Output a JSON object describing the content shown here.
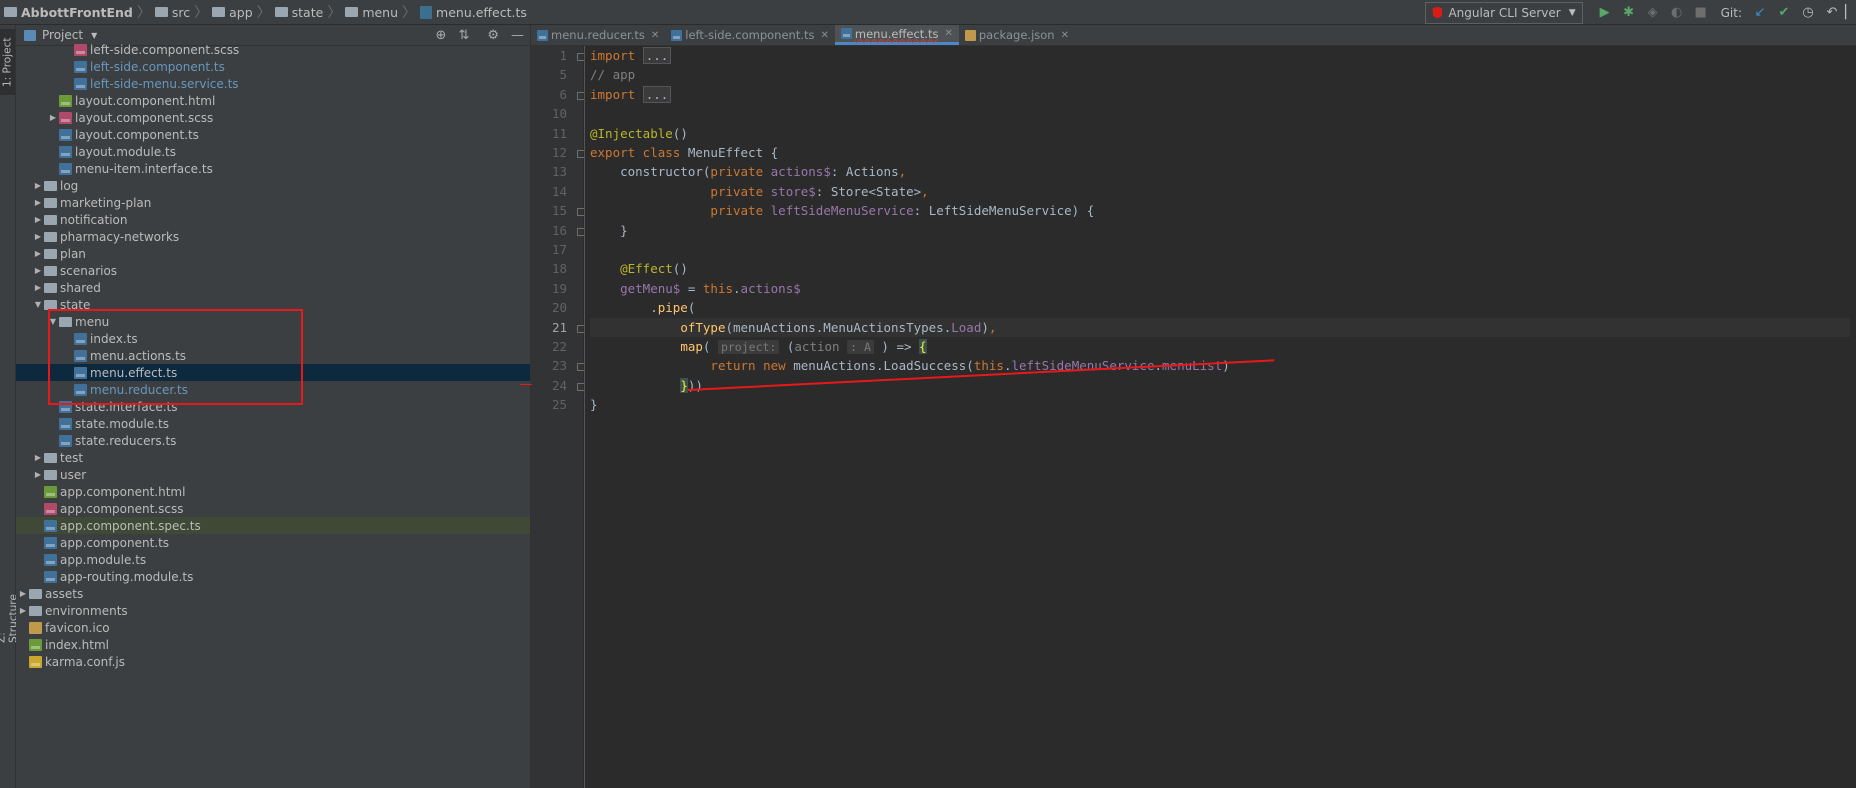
{
  "breadcrumb": [
    {
      "label": "AbbottFrontEnd",
      "icon": "folder-icon"
    },
    {
      "label": "src",
      "icon": "folder-icon"
    },
    {
      "label": "app",
      "icon": "folder-icon"
    },
    {
      "label": "state",
      "icon": "folder-icon"
    },
    {
      "label": "menu",
      "icon": "folder-icon"
    },
    {
      "label": "menu.effect.ts",
      "icon": "typescript-file-icon"
    }
  ],
  "toolbar": {
    "run_config": "Angular CLI Server",
    "vcs_label": "Git:"
  },
  "left_strip": {
    "project_tab": "1: Project",
    "structure_tab": "Z: Structure"
  },
  "project_panel": {
    "title": "Project"
  },
  "tree": [
    {
      "label": "left-side.component.scss",
      "type": "scss",
      "depth": 6,
      "arrow": "",
      "style": ""
    },
    {
      "label": "left-side.component.ts",
      "type": "ts",
      "depth": 6,
      "arrow": "",
      "style": "blue"
    },
    {
      "label": "left-side-menu.service.ts",
      "type": "ts",
      "depth": 6,
      "arrow": "",
      "style": "blue"
    },
    {
      "label": "layout.component.html",
      "type": "html",
      "depth": 5,
      "arrow": "",
      "style": ""
    },
    {
      "label": "layout.component.scss",
      "type": "scss",
      "depth": 5,
      "arrow": "closed",
      "style": ""
    },
    {
      "label": "layout.component.ts",
      "type": "ts",
      "depth": 5,
      "arrow": "",
      "style": ""
    },
    {
      "label": "layout.module.ts",
      "type": "ts",
      "depth": 5,
      "arrow": "",
      "style": ""
    },
    {
      "label": "menu-item.interface.ts",
      "type": "ts",
      "depth": 5,
      "arrow": "",
      "style": ""
    },
    {
      "label": "log",
      "type": "folder",
      "depth": 4,
      "arrow": "closed",
      "style": ""
    },
    {
      "label": "marketing-plan",
      "type": "folder",
      "depth": 4,
      "arrow": "closed",
      "style": ""
    },
    {
      "label": "notification",
      "type": "folder",
      "depth": 4,
      "arrow": "closed",
      "style": ""
    },
    {
      "label": "pharmacy-networks",
      "type": "folder",
      "depth": 4,
      "arrow": "closed",
      "style": ""
    },
    {
      "label": "plan",
      "type": "folder",
      "depth": 4,
      "arrow": "closed",
      "style": ""
    },
    {
      "label": "scenarios",
      "type": "folder",
      "depth": 4,
      "arrow": "closed",
      "style": ""
    },
    {
      "label": "shared",
      "type": "folder",
      "depth": 4,
      "arrow": "closed",
      "style": ""
    },
    {
      "label": "state",
      "type": "folder",
      "depth": 4,
      "arrow": "open",
      "style": ""
    },
    {
      "label": "menu",
      "type": "folder",
      "depth": 5,
      "arrow": "open",
      "style": ""
    },
    {
      "label": "index.ts",
      "type": "ts",
      "depth": 6,
      "arrow": "",
      "style": ""
    },
    {
      "label": "menu.actions.ts",
      "type": "ts",
      "depth": 6,
      "arrow": "",
      "style": ""
    },
    {
      "label": "menu.effect.ts",
      "type": "ts",
      "depth": 6,
      "arrow": "",
      "style": "selected"
    },
    {
      "label": "menu.reducer.ts",
      "type": "ts",
      "depth": 6,
      "arrow": "",
      "style": "blue"
    },
    {
      "label": "state.interface.ts",
      "type": "ts",
      "depth": 5,
      "arrow": "",
      "style": ""
    },
    {
      "label": "state.module.ts",
      "type": "ts",
      "depth": 5,
      "arrow": "",
      "style": ""
    },
    {
      "label": "state.reducers.ts",
      "type": "ts",
      "depth": 5,
      "arrow": "",
      "style": ""
    },
    {
      "label": "test",
      "type": "folder",
      "depth": 4,
      "arrow": "closed",
      "style": ""
    },
    {
      "label": "user",
      "type": "folder",
      "depth": 4,
      "arrow": "closed",
      "style": ""
    },
    {
      "label": "app.component.html",
      "type": "html",
      "depth": 4,
      "arrow": "",
      "style": ""
    },
    {
      "label": "app.component.scss",
      "type": "scss",
      "depth": 4,
      "arrow": "",
      "style": ""
    },
    {
      "label": "app.component.spec.ts",
      "type": "ts",
      "depth": 4,
      "arrow": "",
      "style": "highlight"
    },
    {
      "label": "app.component.ts",
      "type": "ts",
      "depth": 4,
      "arrow": "",
      "style": ""
    },
    {
      "label": "app.module.ts",
      "type": "ts",
      "depth": 4,
      "arrow": "",
      "style": ""
    },
    {
      "label": "app-routing.module.ts",
      "type": "ts",
      "depth": 4,
      "arrow": "",
      "style": ""
    },
    {
      "label": "assets",
      "type": "folder",
      "depth": 3,
      "arrow": "closed",
      "style": ""
    },
    {
      "label": "environments",
      "type": "folder",
      "depth": 3,
      "arrow": "closed",
      "style": ""
    },
    {
      "label": "favicon.ico",
      "type": "ico",
      "depth": 3,
      "arrow": "",
      "style": ""
    },
    {
      "label": "index.html",
      "type": "html",
      "depth": 3,
      "arrow": "",
      "style": ""
    },
    {
      "label": "karma.conf.js",
      "type": "js",
      "depth": 3,
      "arrow": "",
      "style": ""
    }
  ],
  "tabs": [
    {
      "label": "menu.reducer.ts",
      "active": false,
      "err": false,
      "icon": "ts"
    },
    {
      "label": "left-side.component.ts",
      "active": false,
      "err": false,
      "icon": "ts"
    },
    {
      "label": "menu.effect.ts",
      "active": true,
      "err": true,
      "icon": "ts"
    },
    {
      "label": "package.json",
      "active": false,
      "err": false,
      "icon": "json"
    }
  ],
  "line_numbers": [
    "1",
    "5",
    "6",
    "10",
    "11",
    "12",
    "13",
    "14",
    "15",
    "16",
    "17",
    "18",
    "19",
    "20",
    "21",
    "22",
    "23",
    "24",
    "25"
  ],
  "current_line": "21",
  "code": [
    [
      {
        "t": "import ",
        "c": "kw"
      },
      {
        "t": "...",
        "c": "fold-box"
      }
    ],
    [
      {
        "t": "// app",
        "c": "cm"
      }
    ],
    [
      {
        "t": "import ",
        "c": "kw"
      },
      {
        "t": "...",
        "c": "fold-box"
      }
    ],
    [],
    [
      {
        "t": "@Injectable",
        "c": "ann"
      },
      {
        "t": "()",
        "c": ""
      }
    ],
    [
      {
        "t": "export class ",
        "c": "kw"
      },
      {
        "t": "MenuEffect {",
        "c": ""
      }
    ],
    [
      {
        "t": "    constructor(",
        "c": ""
      },
      {
        "t": "private ",
        "c": "kw"
      },
      {
        "t": "actions$",
        "c": "fld"
      },
      {
        "t": ": Actions",
        "c": ""
      },
      {
        "t": ",",
        "c": "kw"
      }
    ],
    [
      {
        "t": "                ",
        "c": ""
      },
      {
        "t": "private ",
        "c": "kw"
      },
      {
        "t": "store$",
        "c": "fld"
      },
      {
        "t": ": Store<State>",
        "c": ""
      },
      {
        "t": ",",
        "c": "kw"
      }
    ],
    [
      {
        "t": "                ",
        "c": ""
      },
      {
        "t": "private ",
        "c": "kw"
      },
      {
        "t": "leftSideMenuService",
        "c": "fld"
      },
      {
        "t": ": LeftSideMenuService) {",
        "c": ""
      }
    ],
    [
      {
        "t": "    }",
        "c": ""
      }
    ],
    [],
    [
      {
        "t": "    ",
        "c": ""
      },
      {
        "t": "@Effect",
        "c": "ann"
      },
      {
        "t": "()",
        "c": ""
      }
    ],
    [
      {
        "t": "    ",
        "c": ""
      },
      {
        "t": "getMenu$",
        "c": "fld"
      },
      {
        "t": " = ",
        "c": ""
      },
      {
        "t": "this",
        "c": "kw"
      },
      {
        "t": ".",
        "c": ""
      },
      {
        "t": "actions$",
        "c": "fld"
      }
    ],
    [
      {
        "t": "        .",
        "c": ""
      },
      {
        "t": "pipe",
        "c": "fn"
      },
      {
        "t": "(",
        "c": ""
      }
    ],
    [
      {
        "t": "            ",
        "c": ""
      },
      {
        "t": "ofType",
        "c": "fn"
      },
      {
        "t": "(menuActions.MenuActionsTypes.",
        "c": ""
      },
      {
        "t": "Load",
        "c": "fld"
      },
      {
        "t": ")",
        "c": ""
      },
      {
        "t": ",",
        "c": "kw"
      }
    ],
    [
      {
        "t": "            ",
        "c": ""
      },
      {
        "t": "map",
        "c": "fn"
      },
      {
        "t": "( ",
        "c": ""
      },
      {
        "t": "project:",
        "c": "hint"
      },
      {
        "t": " (",
        "c": ""
      },
      {
        "t": "action",
        "c": "cm"
      },
      {
        "t": " ",
        "c": ""
      },
      {
        "t": ": A",
        "c": "hint"
      },
      {
        "t": " ) => ",
        "c": ""
      },
      {
        "t": "{",
        "c": "brace-match"
      }
    ],
    [
      {
        "t": "                ",
        "c": ""
      },
      {
        "t": "return new ",
        "c": "kw"
      },
      {
        "t": "menuActions.LoadSuccess(",
        "c": ""
      },
      {
        "t": "this",
        "c": "kw"
      },
      {
        "t": ".",
        "c": ""
      },
      {
        "t": "leftSideMenuService",
        "c": "fld"
      },
      {
        "t": ".",
        "c": ""
      },
      {
        "t": "menuList",
        "c": "fld"
      },
      {
        "t": ")",
        "c": ""
      }
    ],
    [
      {
        "t": "            ",
        "c": ""
      },
      {
        "t": "}",
        "c": "brace-match"
      },
      {
        "t": "))",
        "c": ""
      }
    ],
    [
      {
        "t": "}",
        "c": ""
      }
    ],
    []
  ],
  "colors": {
    "bg": "#2b2b2b",
    "panel": "#3c3f41",
    "selection": "#0d293e",
    "annotation_red": "#e8191a"
  }
}
